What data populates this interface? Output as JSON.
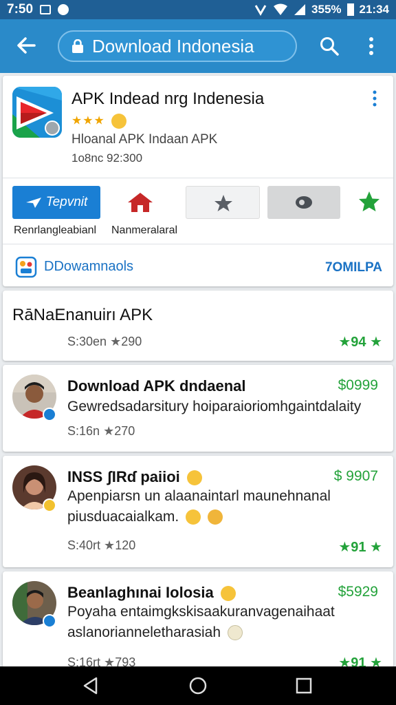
{
  "status_bar": {
    "time": "7:50",
    "battery": "355%",
    "clock": "21:34",
    "icons": [
      "gallery-icon",
      "notification-icon",
      "nfc-icon",
      "wifi-icon",
      "signal-icon",
      "battery-icon"
    ]
  },
  "app_bar": {
    "url": "Download Indonesia",
    "icons": [
      "back-arrow-icon",
      "lock-icon",
      "search-icon",
      "more-vert-icon"
    ]
  },
  "app_card": {
    "title": "APK Indead nrg Indenesia",
    "stars": "★★★",
    "subtitle": "Hloanal APK Indaan APK",
    "count": "1o8nc 92:300",
    "install_label": "Tepvnit",
    "label_left": "Renrlangleabianl",
    "label_right": "Nanmeralaral",
    "downloads_label": "DDowamnaols",
    "downloads_size": "7OMILPA"
  },
  "post_main": {
    "title": "RāNaEnanuirı APK",
    "meta_left": "S:30en",
    "meta_count": "290",
    "rating": "94"
  },
  "posts": [
    {
      "title": "Download APK dndaenal",
      "price": "$0999",
      "body": "Gewredsadarsitury hoiparaioriomhgaintdalaity",
      "meta_left": "S:16n",
      "meta_count": "270",
      "rating": ""
    },
    {
      "title": "INSS ʃIRɗ paiioi",
      "price": "$ 9907",
      "body": "Apenpiarsn un alaanaintarl maunehnanal piusduacaialkam.",
      "meta_left": "S:40rt",
      "meta_count": "120",
      "rating": "91"
    },
    {
      "title": "Beanlaghınai Iolosia",
      "price": "$5929",
      "body": "Poyaha entaimgkskisaakuranvagenaihaat aslanorianneletharasiah",
      "meta_left": "S:16rt",
      "meta_count": "793",
      "rating": "91"
    }
  ],
  "colors": {
    "status_bar": "#1f5f95",
    "app_bar": "#2a8ac9",
    "accent_blue": "#1a7fd4",
    "green": "#23a23a"
  }
}
